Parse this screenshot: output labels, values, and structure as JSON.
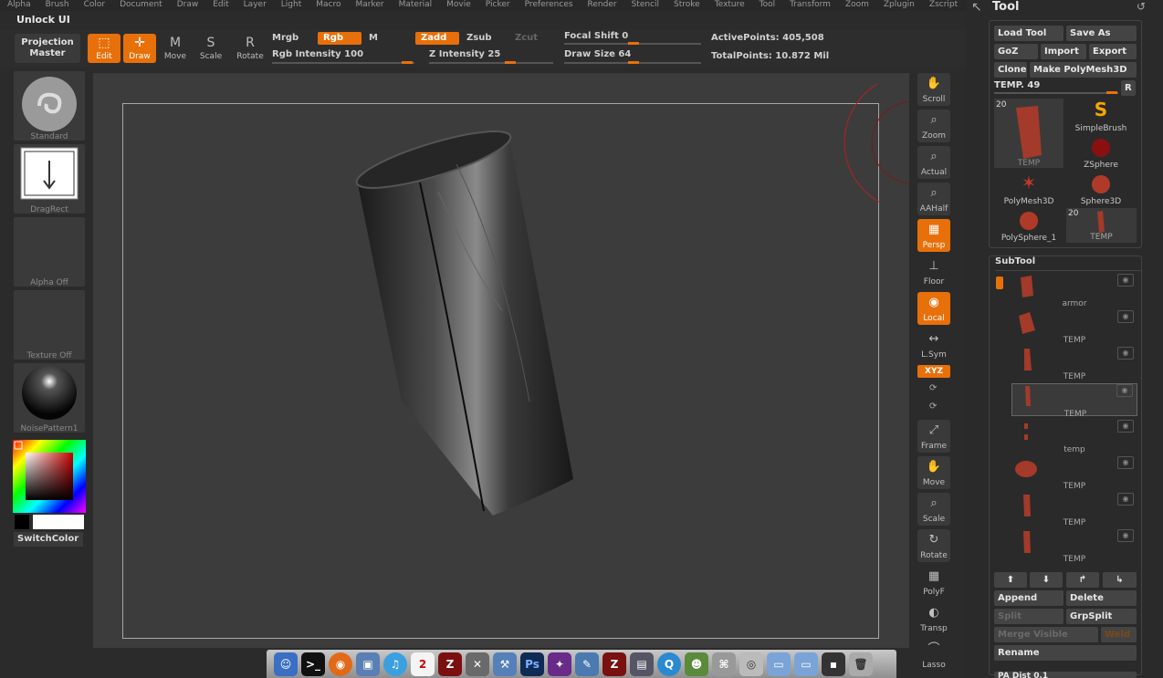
{
  "menu": [
    "Alpha",
    "Brush",
    "Color",
    "Document",
    "Draw",
    "Edit",
    "Layer",
    "Light",
    "Macro",
    "Marker",
    "Material",
    "Movie",
    "Picker",
    "Preferences",
    "Render",
    "Stencil",
    "Stroke",
    "Texture",
    "Tool",
    "Transform",
    "Zoom",
    "Zplugin",
    "Zscript"
  ],
  "unlock_ui": "Unlock UI",
  "toolbar": {
    "projection_master": "Projection Master",
    "edit": "Edit",
    "draw": "Draw",
    "move": "Move",
    "scale": "Scale",
    "rotate": "Rotate",
    "mrgb": "Mrgb",
    "rgb": "Rgb",
    "m": "M",
    "zadd": "Zadd",
    "zsub": "Zsub",
    "zcut": "Zcut",
    "rgb_intensity": "Rgb Intensity 100",
    "z_intensity": "Z Intensity 25",
    "focal_shift": "Focal Shift 0",
    "draw_size": "Draw Size 64",
    "active_points": "ActivePoints: 405,508",
    "total_points": "TotalPoints: 10.872 Mil"
  },
  "left_panel": {
    "brush_label": "Standard",
    "stroke_label": "DragRect",
    "alpha_label": "Alpha Off",
    "texture_label": "Texture Off",
    "material_label": "NoisePattern1",
    "switch_color": "SwitchColor"
  },
  "shelf": {
    "scroll": "Scroll",
    "zoom": "Zoom",
    "actual": "Actual",
    "aahalf": "AAHalf",
    "persp": "Persp",
    "floor": "Floor",
    "local": "Local",
    "lsym": "L.Sym",
    "xyz": "XYZ",
    "frame": "Frame",
    "move": "Move",
    "scale": "Scale",
    "rotate": "Rotate",
    "polyf": "PolyF",
    "transp": "Transp",
    "lasso": "Lasso"
  },
  "tool_panel": {
    "title": "Tool",
    "load_tool": "Load Tool",
    "save_as": "Save As",
    "goz": "GoZ",
    "import": "Import",
    "export": "Export",
    "clone": "Clone",
    "make_polymesh": "Make PolyMesh3D",
    "temp_slider": "TEMP. 49",
    "r_button": "R",
    "tools": [
      {
        "label": "TEMP",
        "count": "20"
      },
      {
        "label": "SimpleBrush",
        "count": ""
      },
      {
        "label": "ZSphere",
        "count": ""
      },
      {
        "label": "PolyMesh3D",
        "count": ""
      },
      {
        "label": "Sphere3D",
        "count": ""
      },
      {
        "label": "PolySphere_1",
        "count": ""
      },
      {
        "label": "TEMP",
        "count": "20"
      }
    ],
    "subtool_title": "SubTool",
    "subtools": [
      "armor",
      "TEMP",
      "TEMP",
      "TEMP",
      "temp",
      "TEMP",
      "TEMP",
      "TEMP"
    ],
    "append": "Append",
    "delete": "Delete",
    "split": "Split",
    "grpsplit": "GrpSplit",
    "merge_visible": "Merge Visible",
    "weld": "Weld",
    "rename": "Rename",
    "pa_dist": "PA Dist 0.1"
  },
  "colors": {
    "accent": "#e8700a",
    "panel": "#2a2a2a",
    "canvas": "#3c3c3c"
  }
}
